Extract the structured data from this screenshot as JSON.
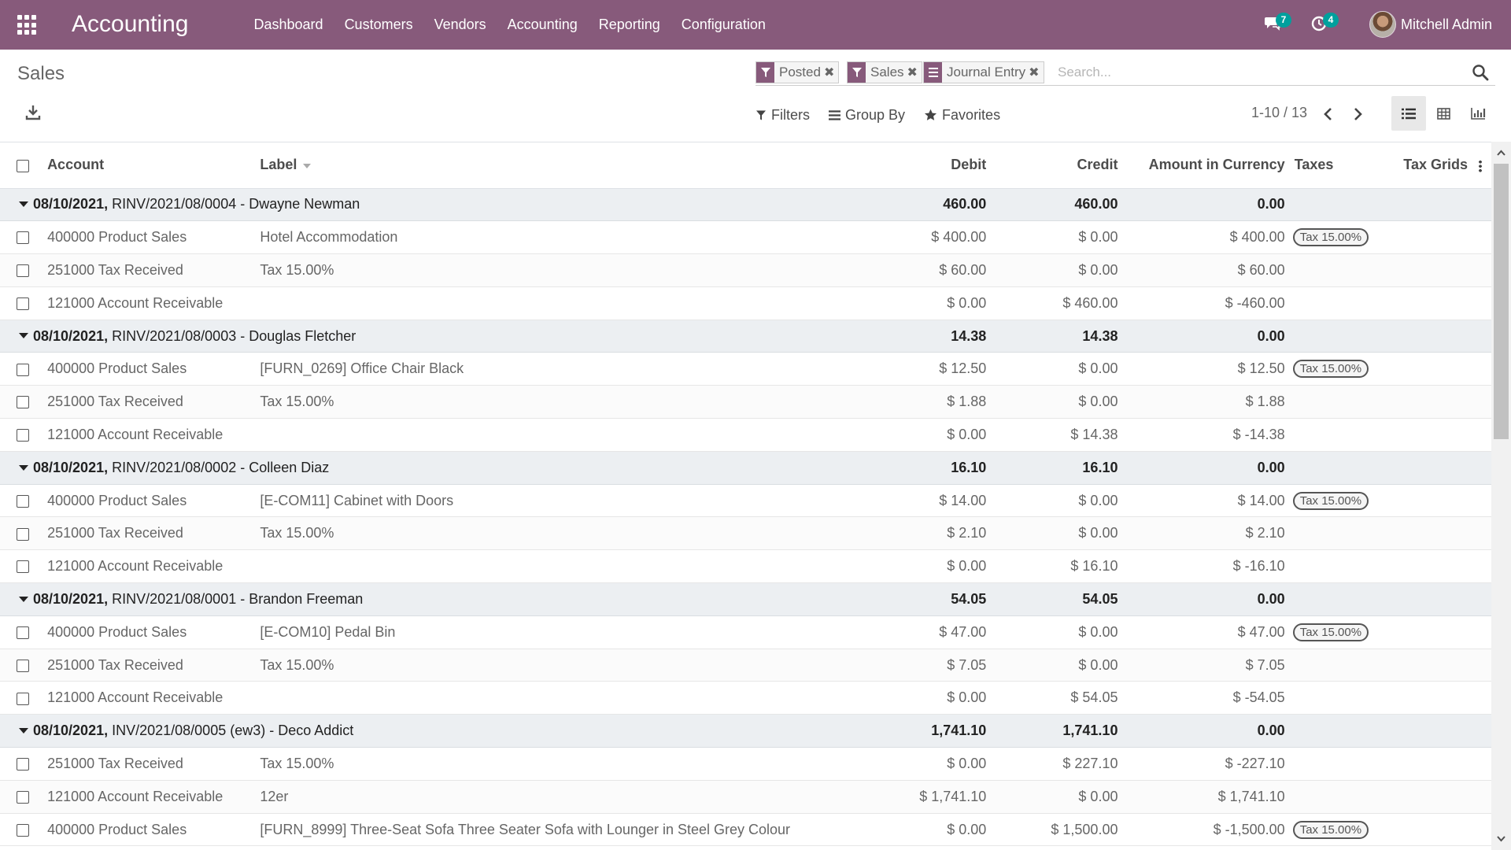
{
  "navbar": {
    "app_title": "Accounting",
    "menu": [
      "Dashboard",
      "Customers",
      "Vendors",
      "Accounting",
      "Reporting",
      "Configuration"
    ],
    "messages_count": "7",
    "activities_count": "4",
    "user_name": "Mitchell Admin",
    "color": "#875a7b"
  },
  "control_panel": {
    "breadcrumb": "Sales",
    "facets": [
      {
        "icon": "filter-icon",
        "label": "Posted"
      },
      {
        "icon": "filter-icon",
        "label": "Sales"
      },
      {
        "icon": "group-by-icon",
        "label": "Journal Entry"
      }
    ],
    "search_placeholder": "Search...",
    "filters_label": "Filters",
    "group_by_label": "Group By",
    "favorites_label": "Favorites",
    "pager": "1-10 / 13"
  },
  "table": {
    "columns": {
      "account": "Account",
      "label": "Label",
      "debit": "Debit",
      "credit": "Credit",
      "amount_currency": "Amount in Currency",
      "taxes": "Taxes",
      "tax_grids": "Tax Grids"
    },
    "groups": [
      {
        "date": "08/10/2021,",
        "title": " RINV/2021/08/0004 - Dwayne Newman",
        "debit": "460.00",
        "credit": "460.00",
        "amount": "0.00",
        "lines": [
          {
            "account": "400000 Product Sales",
            "label": "Hotel Accommodation",
            "debit": "$ 400.00",
            "credit": "$ 0.00",
            "amount": "$ 400.00",
            "tax": "Tax 15.00%"
          },
          {
            "account": "251000 Tax Received",
            "label": "Tax 15.00%",
            "debit": "$ 60.00",
            "credit": "$ 0.00",
            "amount": "$ 60.00",
            "tax": ""
          },
          {
            "account": "121000 Account Receivable",
            "label": "",
            "debit": "$ 0.00",
            "credit": "$ 460.00",
            "amount": "$ -460.00",
            "tax": ""
          }
        ]
      },
      {
        "date": "08/10/2021,",
        "title": " RINV/2021/08/0003 - Douglas Fletcher",
        "debit": "14.38",
        "credit": "14.38",
        "amount": "0.00",
        "lines": [
          {
            "account": "400000 Product Sales",
            "label": "[FURN_0269] Office Chair Black",
            "debit": "$ 12.50",
            "credit": "$ 0.00",
            "amount": "$ 12.50",
            "tax": "Tax 15.00%"
          },
          {
            "account": "251000 Tax Received",
            "label": "Tax 15.00%",
            "debit": "$ 1.88",
            "credit": "$ 0.00",
            "amount": "$ 1.88",
            "tax": ""
          },
          {
            "account": "121000 Account Receivable",
            "label": "",
            "debit": "$ 0.00",
            "credit": "$ 14.38",
            "amount": "$ -14.38",
            "tax": ""
          }
        ]
      },
      {
        "date": "08/10/2021,",
        "title": " RINV/2021/08/0002 - Colleen Diaz",
        "debit": "16.10",
        "credit": "16.10",
        "amount": "0.00",
        "lines": [
          {
            "account": "400000 Product Sales",
            "label": "[E-COM11] Cabinet with Doors",
            "debit": "$ 14.00",
            "credit": "$ 0.00",
            "amount": "$ 14.00",
            "tax": "Tax 15.00%"
          },
          {
            "account": "251000 Tax Received",
            "label": "Tax 15.00%",
            "debit": "$ 2.10",
            "credit": "$ 0.00",
            "amount": "$ 2.10",
            "tax": ""
          },
          {
            "account": "121000 Account Receivable",
            "label": "",
            "debit": "$ 0.00",
            "credit": "$ 16.10",
            "amount": "$ -16.10",
            "tax": ""
          }
        ]
      },
      {
        "date": "08/10/2021,",
        "title": " RINV/2021/08/0001 - Brandon Freeman",
        "debit": "54.05",
        "credit": "54.05",
        "amount": "0.00",
        "lines": [
          {
            "account": "400000 Product Sales",
            "label": "[E-COM10] Pedal Bin",
            "debit": "$ 47.00",
            "credit": "$ 0.00",
            "amount": "$ 47.00",
            "tax": "Tax 15.00%"
          },
          {
            "account": "251000 Tax Received",
            "label": "Tax 15.00%",
            "debit": "$ 7.05",
            "credit": "$ 0.00",
            "amount": "$ 7.05",
            "tax": ""
          },
          {
            "account": "121000 Account Receivable",
            "label": "",
            "debit": "$ 0.00",
            "credit": "$ 54.05",
            "amount": "$ -54.05",
            "tax": ""
          }
        ]
      },
      {
        "date": "08/10/2021,",
        "title": " INV/2021/08/0005    (ew3) - Deco Addict",
        "debit": "1,741.10",
        "credit": "1,741.10",
        "amount": "0.00",
        "lines": [
          {
            "account": "251000 Tax Received",
            "label": "Tax 15.00%",
            "debit": "$ 0.00",
            "credit": "$ 227.10",
            "amount": "$ -227.10",
            "tax": ""
          },
          {
            "account": "121000 Account Receivable",
            "label": "12er",
            "debit": "$ 1,741.10",
            "credit": "$ 0.00",
            "amount": "$ 1,741.10",
            "tax": ""
          },
          {
            "account": "400000 Product Sales",
            "label": "[FURN_8999] Three-Seat Sofa Three Seater Sofa with Lounger in Steel Grey Colour",
            "debit": "$ 0.00",
            "credit": "$ 1,500.00",
            "amount": "$ -1,500.00",
            "tax": "Tax 15.00%"
          }
        ]
      }
    ]
  }
}
